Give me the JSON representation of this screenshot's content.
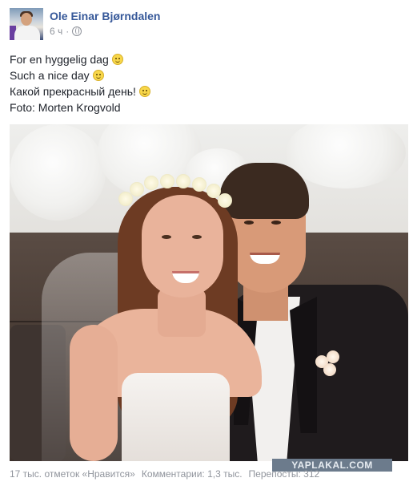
{
  "post": {
    "author": "Ole Einar Bjørndalen",
    "time": "6 ч",
    "separator": "·",
    "lines": [
      "For en hyggelig dag",
      "Such a nice day",
      "Какой прекрасный день!",
      "Foto: Morten Krogvold"
    ]
  },
  "footer": {
    "likes": "17 тыс. отметок «Нравится»",
    "comments": "Комментарии: 1,3 тыс.",
    "shares": "Перепосты: 312"
  },
  "watermark": "YAPLAKAL.COM",
  "icons": {
    "privacy": "globe-icon",
    "emoji": "smiley-icon"
  },
  "colors": {
    "author_link": "#365899",
    "meta_text": "#90949c",
    "body_text": "#1d2129"
  }
}
